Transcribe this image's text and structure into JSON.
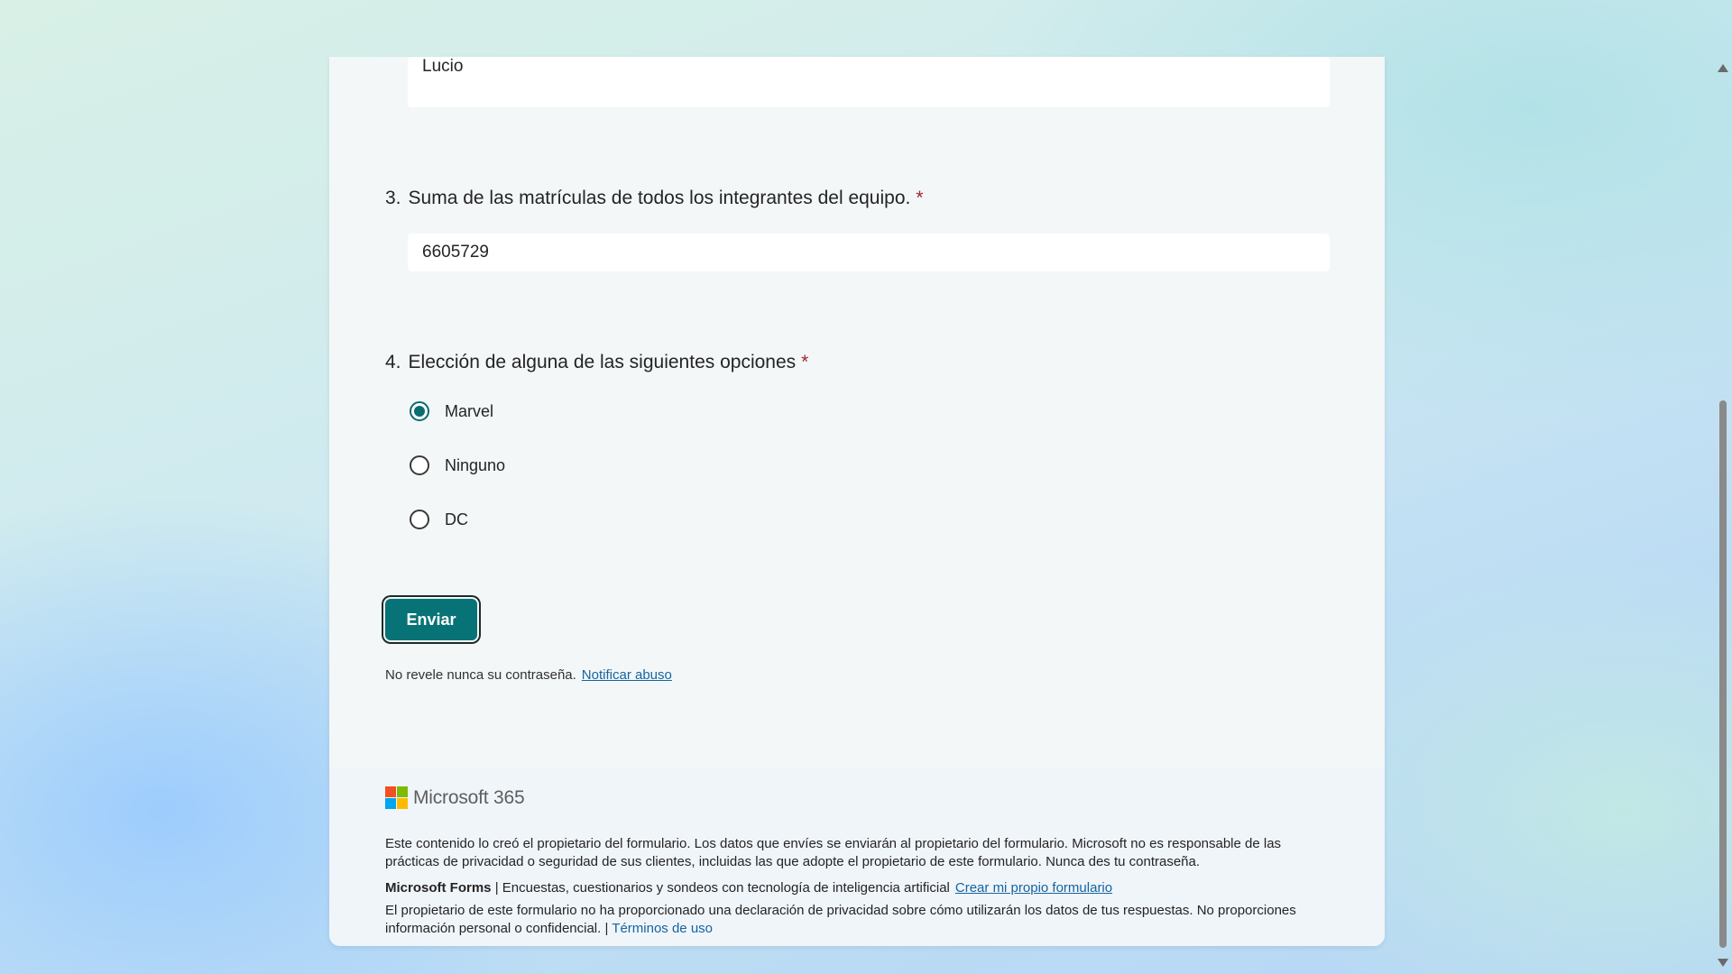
{
  "form": {
    "answer_q2": "Lucio",
    "q3": {
      "number": "3.",
      "text": "Suma de las matrículas de todos los integrantes del equipo.",
      "required_mark": "*",
      "answer": "6605729"
    },
    "q4": {
      "number": "4.",
      "text": "Elección de alguna de las siguientes opciones",
      "required_mark": "*",
      "options": [
        {
          "label": "Marvel",
          "selected": true
        },
        {
          "label": "Ninguno",
          "selected": false
        },
        {
          "label": "DC",
          "selected": false
        }
      ]
    },
    "submit_label": "Enviar",
    "notice_text": "No revele nunca su contraseña.",
    "report_abuse_link": "Notificar abuso"
  },
  "footer": {
    "brand": "Microsoft 365",
    "logo_colors": [
      "#f25022",
      "#7fba00",
      "#00a4ef",
      "#ffb900"
    ],
    "disclaimer": "Este contenido lo creó el propietario del formulario. Los datos que envíes se enviarán al propietario del formulario. Microsoft no es responsable de las prácticas de privacidad o seguridad de sus clientes, incluidas las que adopte el propietario de este formulario. Nunca des tu contraseña.",
    "forms_name": "Microsoft Forms",
    "forms_tagline": "| Encuestas, cuestionarios y sondeos con tecnología de inteligencia artificial",
    "create_link": "Crear mi propio formulario",
    "privacy_text": "El propietario de este formulario no ha proporcionado una declaración de privacidad sobre cómo utilizarán los datos de tus respuestas. No proporciones información personal o confidencial. |",
    "terms_link": "Términos de uso"
  },
  "colors": {
    "accent": "#077377",
    "required": "#a4262c",
    "link": "#1464a0"
  }
}
